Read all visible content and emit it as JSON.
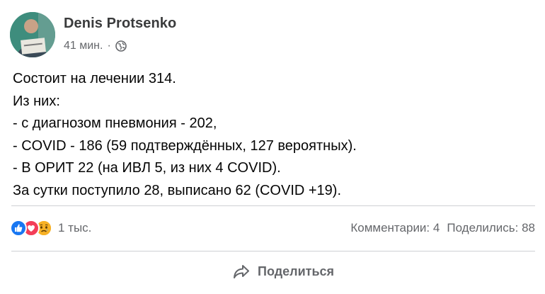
{
  "post": {
    "author": "Denis Protsenko",
    "time": "41 мин.",
    "separator": "·",
    "privacy_icon": "globe-icon",
    "text_lines": [
      "Состоит на лечении 314.",
      "Из них:",
      "- с диагнозом пневмония - 202,",
      "- COVID - 186 (59 подтверждённых, 127 вероятных).",
      "- В ОРИТ 22 (на ИВЛ 5, из них 4 COVID).",
      "За сутки поступило 28, выписано 62 (COVID +19)."
    ]
  },
  "reactions": {
    "icons": [
      "like-icon",
      "love-icon",
      "sad-icon"
    ],
    "count": "1 тыс."
  },
  "stats": {
    "comments": "Комментарии: 4",
    "shares": "Поделились: 88"
  },
  "actions": {
    "share_label": "Поделиться"
  },
  "colors": {
    "like": "#1877f2",
    "love": "#f33e58",
    "sad": "#f7b125",
    "secondary_text": "#65676b",
    "divider": "#ced0d4"
  }
}
